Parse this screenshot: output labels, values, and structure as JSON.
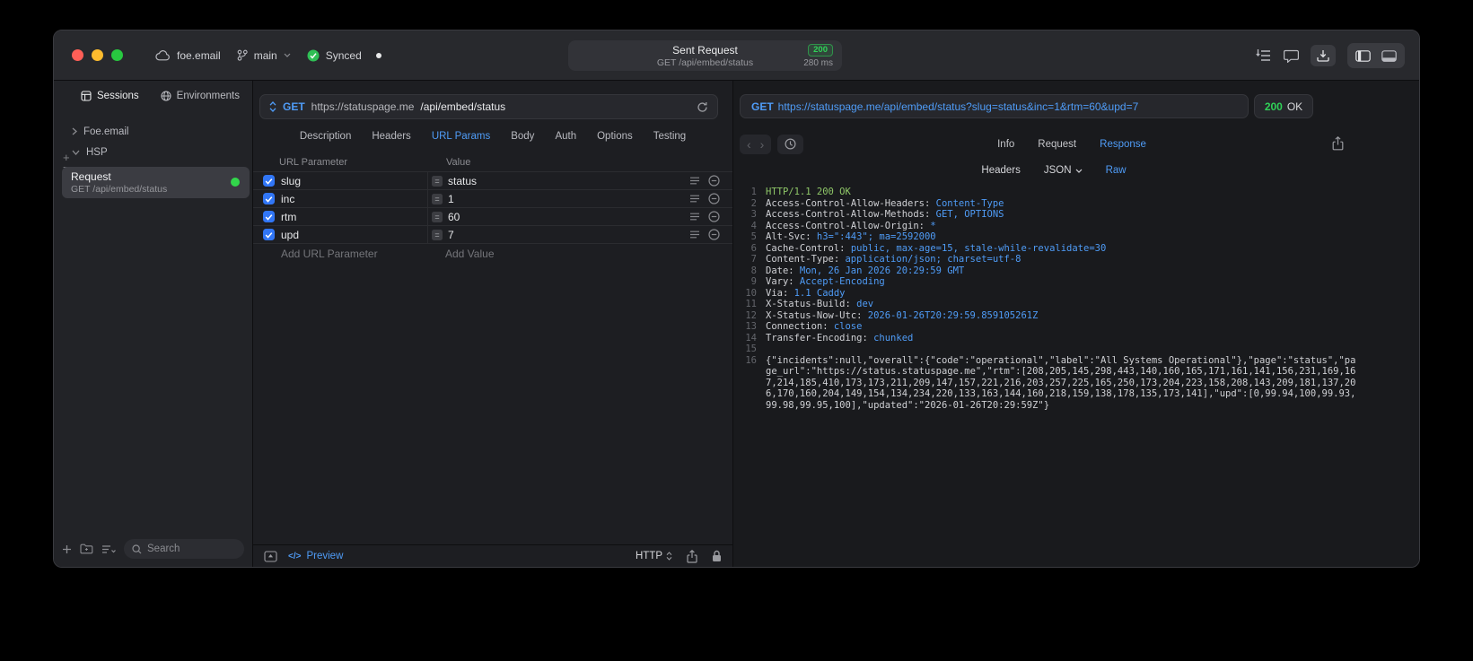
{
  "icons": {
    "plus": "+",
    "minus": "−",
    "back": "‹",
    "forward": "›",
    "equals": "=",
    "code": "</>"
  },
  "titlebar": {
    "project": "foe.email",
    "branch": "main",
    "sync": "Synced",
    "request_pill": {
      "title": "Sent Request",
      "status": "200",
      "subtitle": "GET /api/embed/status",
      "duration": "280 ms"
    }
  },
  "sidebar": {
    "tabs": [
      {
        "label": "Sessions"
      },
      {
        "label": "Environments"
      }
    ],
    "tree": [
      {
        "label": "Foe.email"
      },
      {
        "label": "HSP"
      }
    ],
    "request": {
      "title": "Request",
      "subtitle": "GET /api/embed/status"
    },
    "search": {
      "placeholder": "Search"
    }
  },
  "request_editor": {
    "method": "GET",
    "url_host": "https://statuspage.me",
    "url_path": "/api/embed/status",
    "tabs": [
      "Description",
      "Headers",
      "URL Params",
      "Body",
      "Auth",
      "Options",
      "Testing"
    ],
    "columns": {
      "param": "URL Parameter",
      "value": "Value"
    },
    "params": [
      {
        "name": "slug",
        "value": "status"
      },
      {
        "name": "inc",
        "value": "1"
      },
      {
        "name": "rtm",
        "value": "60"
      },
      {
        "name": "upd",
        "value": "7"
      }
    ],
    "add_param": "Add URL Parameter",
    "add_value": "Add Value",
    "footer": {
      "preview": "Preview",
      "http": "HTTP"
    }
  },
  "response": {
    "request_line": {
      "method": "GET",
      "url": "https://statuspage.me/api/embed/status?slug=status&inc=1&rtm=60&upd=7"
    },
    "status": {
      "code": "200",
      "text": "OK"
    },
    "tabs": [
      "Info",
      "Request",
      "Response"
    ],
    "subtabs": [
      "Headers",
      "JSON",
      "Raw"
    ],
    "status_line": {
      "n": "1",
      "text": "HTTP/1.1 200 OK"
    },
    "headers": [
      {
        "n": "2",
        "name": "Access-Control-Allow-Headers:",
        "value": "Content-Type"
      },
      {
        "n": "3",
        "name": "Access-Control-Allow-Methods:",
        "value": "GET, OPTIONS"
      },
      {
        "n": "4",
        "name": "Access-Control-Allow-Origin:",
        "value": "*"
      },
      {
        "n": "5",
        "name": "Alt-Svc:",
        "value": "h3=\":443\"; ma=2592000"
      },
      {
        "n": "6",
        "name": "Cache-Control:",
        "value": "public, max-age=15, stale-while-revalidate=30"
      },
      {
        "n": "7",
        "name": "Content-Type:",
        "value": "application/json; charset=utf-8"
      },
      {
        "n": "8",
        "name": "Date:",
        "value": "Mon, 26 Jan 2026 20:29:59 GMT"
      },
      {
        "n": "9",
        "name": "Vary:",
        "value": "Accept-Encoding"
      },
      {
        "n": "10",
        "name": "Via:",
        "value": "1.1 Caddy"
      },
      {
        "n": "11",
        "name": "X-Status-Build:",
        "value": "dev"
      },
      {
        "n": "12",
        "name": "X-Status-Now-Utc:",
        "value": "2026-01-26T20:29:59.859105261Z"
      },
      {
        "n": "13",
        "name": "Connection:",
        "value": "close"
      },
      {
        "n": "14",
        "name": "Transfer-Encoding:",
        "value": "chunked"
      }
    ],
    "blank_line_n": "15",
    "body": {
      "n": "16",
      "text": "{\"incidents\":null,\"overall\":{\"code\":\"operational\",\"label\":\"All Systems Operational\"},\"page\":\"status\",\"page_url\":\"https://status.statuspage.me\",\"rtm\":[208,205,145,298,443,140,160,165,171,161,141,156,231,169,167,214,185,410,173,173,211,209,147,157,221,216,203,257,225,165,250,173,204,223,158,208,143,209,181,137,206,170,160,204,149,154,134,234,220,133,163,144,160,218,159,138,178,135,173,141],\"upd\":[0,99.94,100,99.93,99.98,99.95,100],\"updated\":\"2026-01-26T20:29:59Z\"}"
    }
  }
}
